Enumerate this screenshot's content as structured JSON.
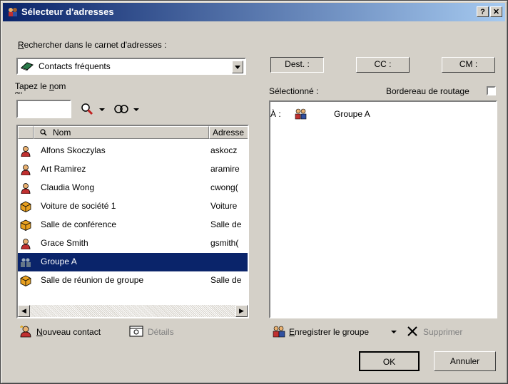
{
  "window": {
    "title": "Sélecteur d'adresses",
    "help_label": "?",
    "close_label": "✕"
  },
  "search": {
    "label": "Rechercher dans le carnet d'adresses :",
    "addressbook_selected": "Contacts fréquents",
    "type_name_label": "Tapez le nom",
    "type_name_label_2": "ou",
    "name_value": ""
  },
  "list": {
    "columns": [
      "Nom",
      "Adresse"
    ],
    "rows": [
      {
        "name": "Alfons Skoczylas",
        "address": "askocz",
        "type": "person"
      },
      {
        "name": "Art Ramirez",
        "address": "aramire",
        "type": "person"
      },
      {
        "name": "Claudia Wong",
        "address": "cwong(",
        "type": "person"
      },
      {
        "name": "Voiture de société 1",
        "address": "Voiture",
        "type": "resource"
      },
      {
        "name": "Salle de conférence",
        "address": "Salle de",
        "type": "resource"
      },
      {
        "name": "Grace Smith",
        "address": "gsmith(",
        "type": "person"
      },
      {
        "name": "Groupe A",
        "address": "",
        "type": "group",
        "selected": true
      },
      {
        "name": "Salle de réunion de groupe",
        "address": "Salle de",
        "type": "resource"
      }
    ]
  },
  "recipients": {
    "to_button": "Dest. :",
    "cc_button": "CC :",
    "bc_button": "CM :",
    "selected_label": "Sélectionné :",
    "routing_label": "Bordereau de routage",
    "routing_checked": false,
    "entries": [
      {
        "prefix": "À :",
        "name": "Groupe A"
      }
    ]
  },
  "actions": {
    "new_contact": "Nouveau contact",
    "details": "Détails",
    "save_group": "Enregistrer le groupe",
    "remove": "Supprimer",
    "ok": "OK",
    "cancel": "Annuler"
  },
  "colors": {
    "title_start": "#0a246a",
    "title_end": "#a6caf0",
    "selection": "#0a246a",
    "face": "#d4d0c8"
  }
}
